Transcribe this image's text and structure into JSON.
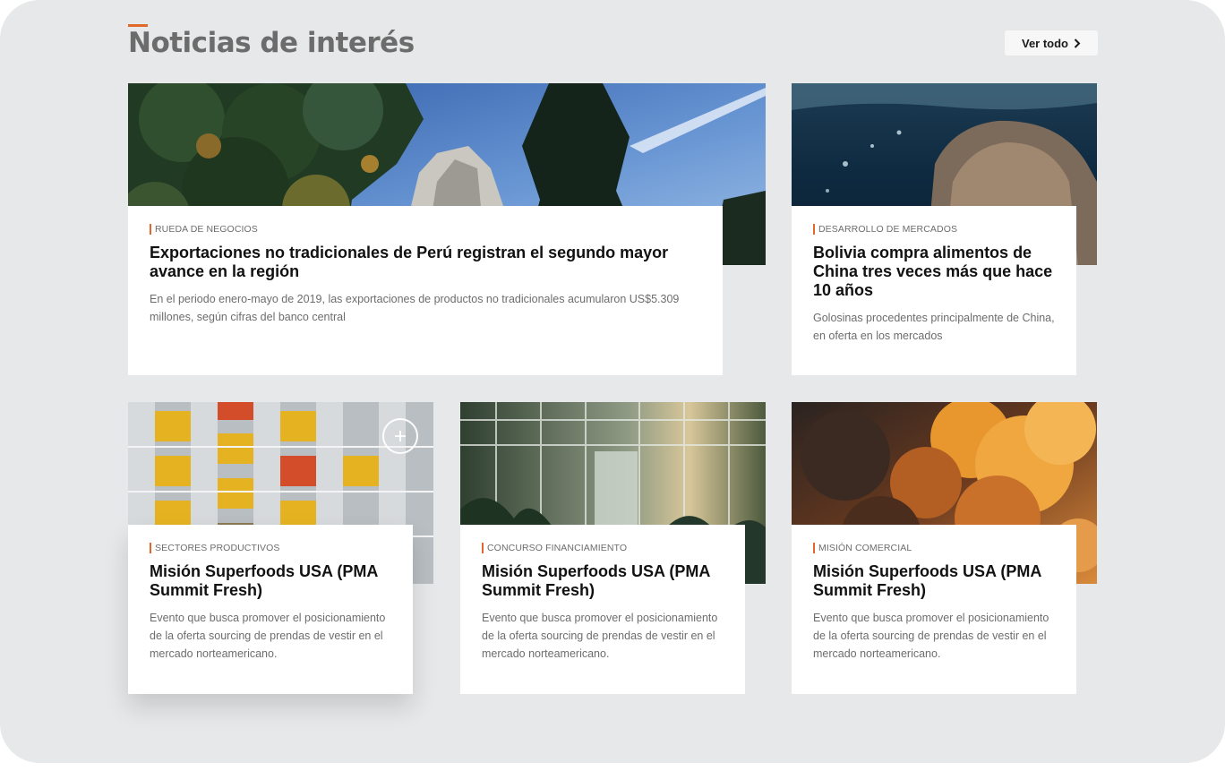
{
  "section": {
    "title": "Noticias de interés",
    "see_all_label": "Ver todo",
    "accent_color": "#e1672b"
  },
  "cards": [
    {
      "category": "RUEDA DE NEGOCIOS",
      "title": "Exportaciones no tradicionales de Perú registran el segundo mayor avance en la región",
      "description": "En el periodo enero-mayo de 2019, las exportaciones de productos no tradicionales acumularon US$5.309 millones, según cifras del banco central"
    },
    {
      "category": "DESARROLLO DE MERCADOS",
      "title": "Bolivia compra alimentos de China tres veces más que hace 10 años",
      "description": "Golosinas procedentes principalmente de China, en oferta en los mercados"
    },
    {
      "category": "SECTORES PRODUCTIVOS",
      "title": "Misión Superfoods USA (PMA Summit Fresh)",
      "description": "Evento que busca promover el posicionamiento de la oferta sourcing de prendas de vestir en el mercado norteamericano."
    },
    {
      "category": "CONCURSO FINANCIAMIENTO",
      "title": "Misión Superfoods USA (PMA Summit Fresh)",
      "description": "Evento que busca promover el posicionamiento de la oferta sourcing de prendas de vestir en el mercado norteamericano."
    },
    {
      "category": "MISIÓN COMERCIAL",
      "title": "Misión Superfoods USA (PMA Summit Fresh)",
      "description": "Evento que busca promover el posicionamiento de la oferta sourcing de prendas de vestir en el mercado norteamericano."
    }
  ],
  "icons": {
    "see_all": "chevron-right-icon",
    "expand": "plus-icon"
  }
}
